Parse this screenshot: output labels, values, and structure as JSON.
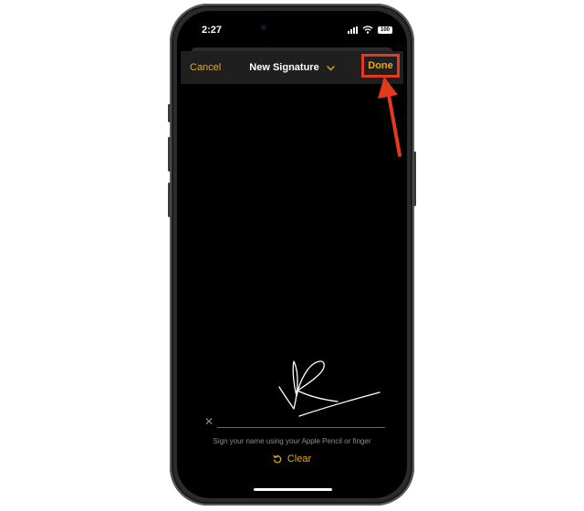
{
  "status_bar": {
    "time": "2:27",
    "battery": "100"
  },
  "nav": {
    "cancel_label": "Cancel",
    "title": "New Signature",
    "done_label": "Done"
  },
  "canvas": {
    "baseline_mark": "✕",
    "hint": "Sign your name using your Apple Pencil or finger",
    "clear_label": "Clear"
  },
  "colors": {
    "accent": "#e4a821",
    "highlight": "#e13a1e",
    "background": "#000000"
  },
  "icons": [
    "signal-icon",
    "wifi-icon",
    "battery-icon",
    "chevron-down-icon",
    "undo-icon"
  ]
}
